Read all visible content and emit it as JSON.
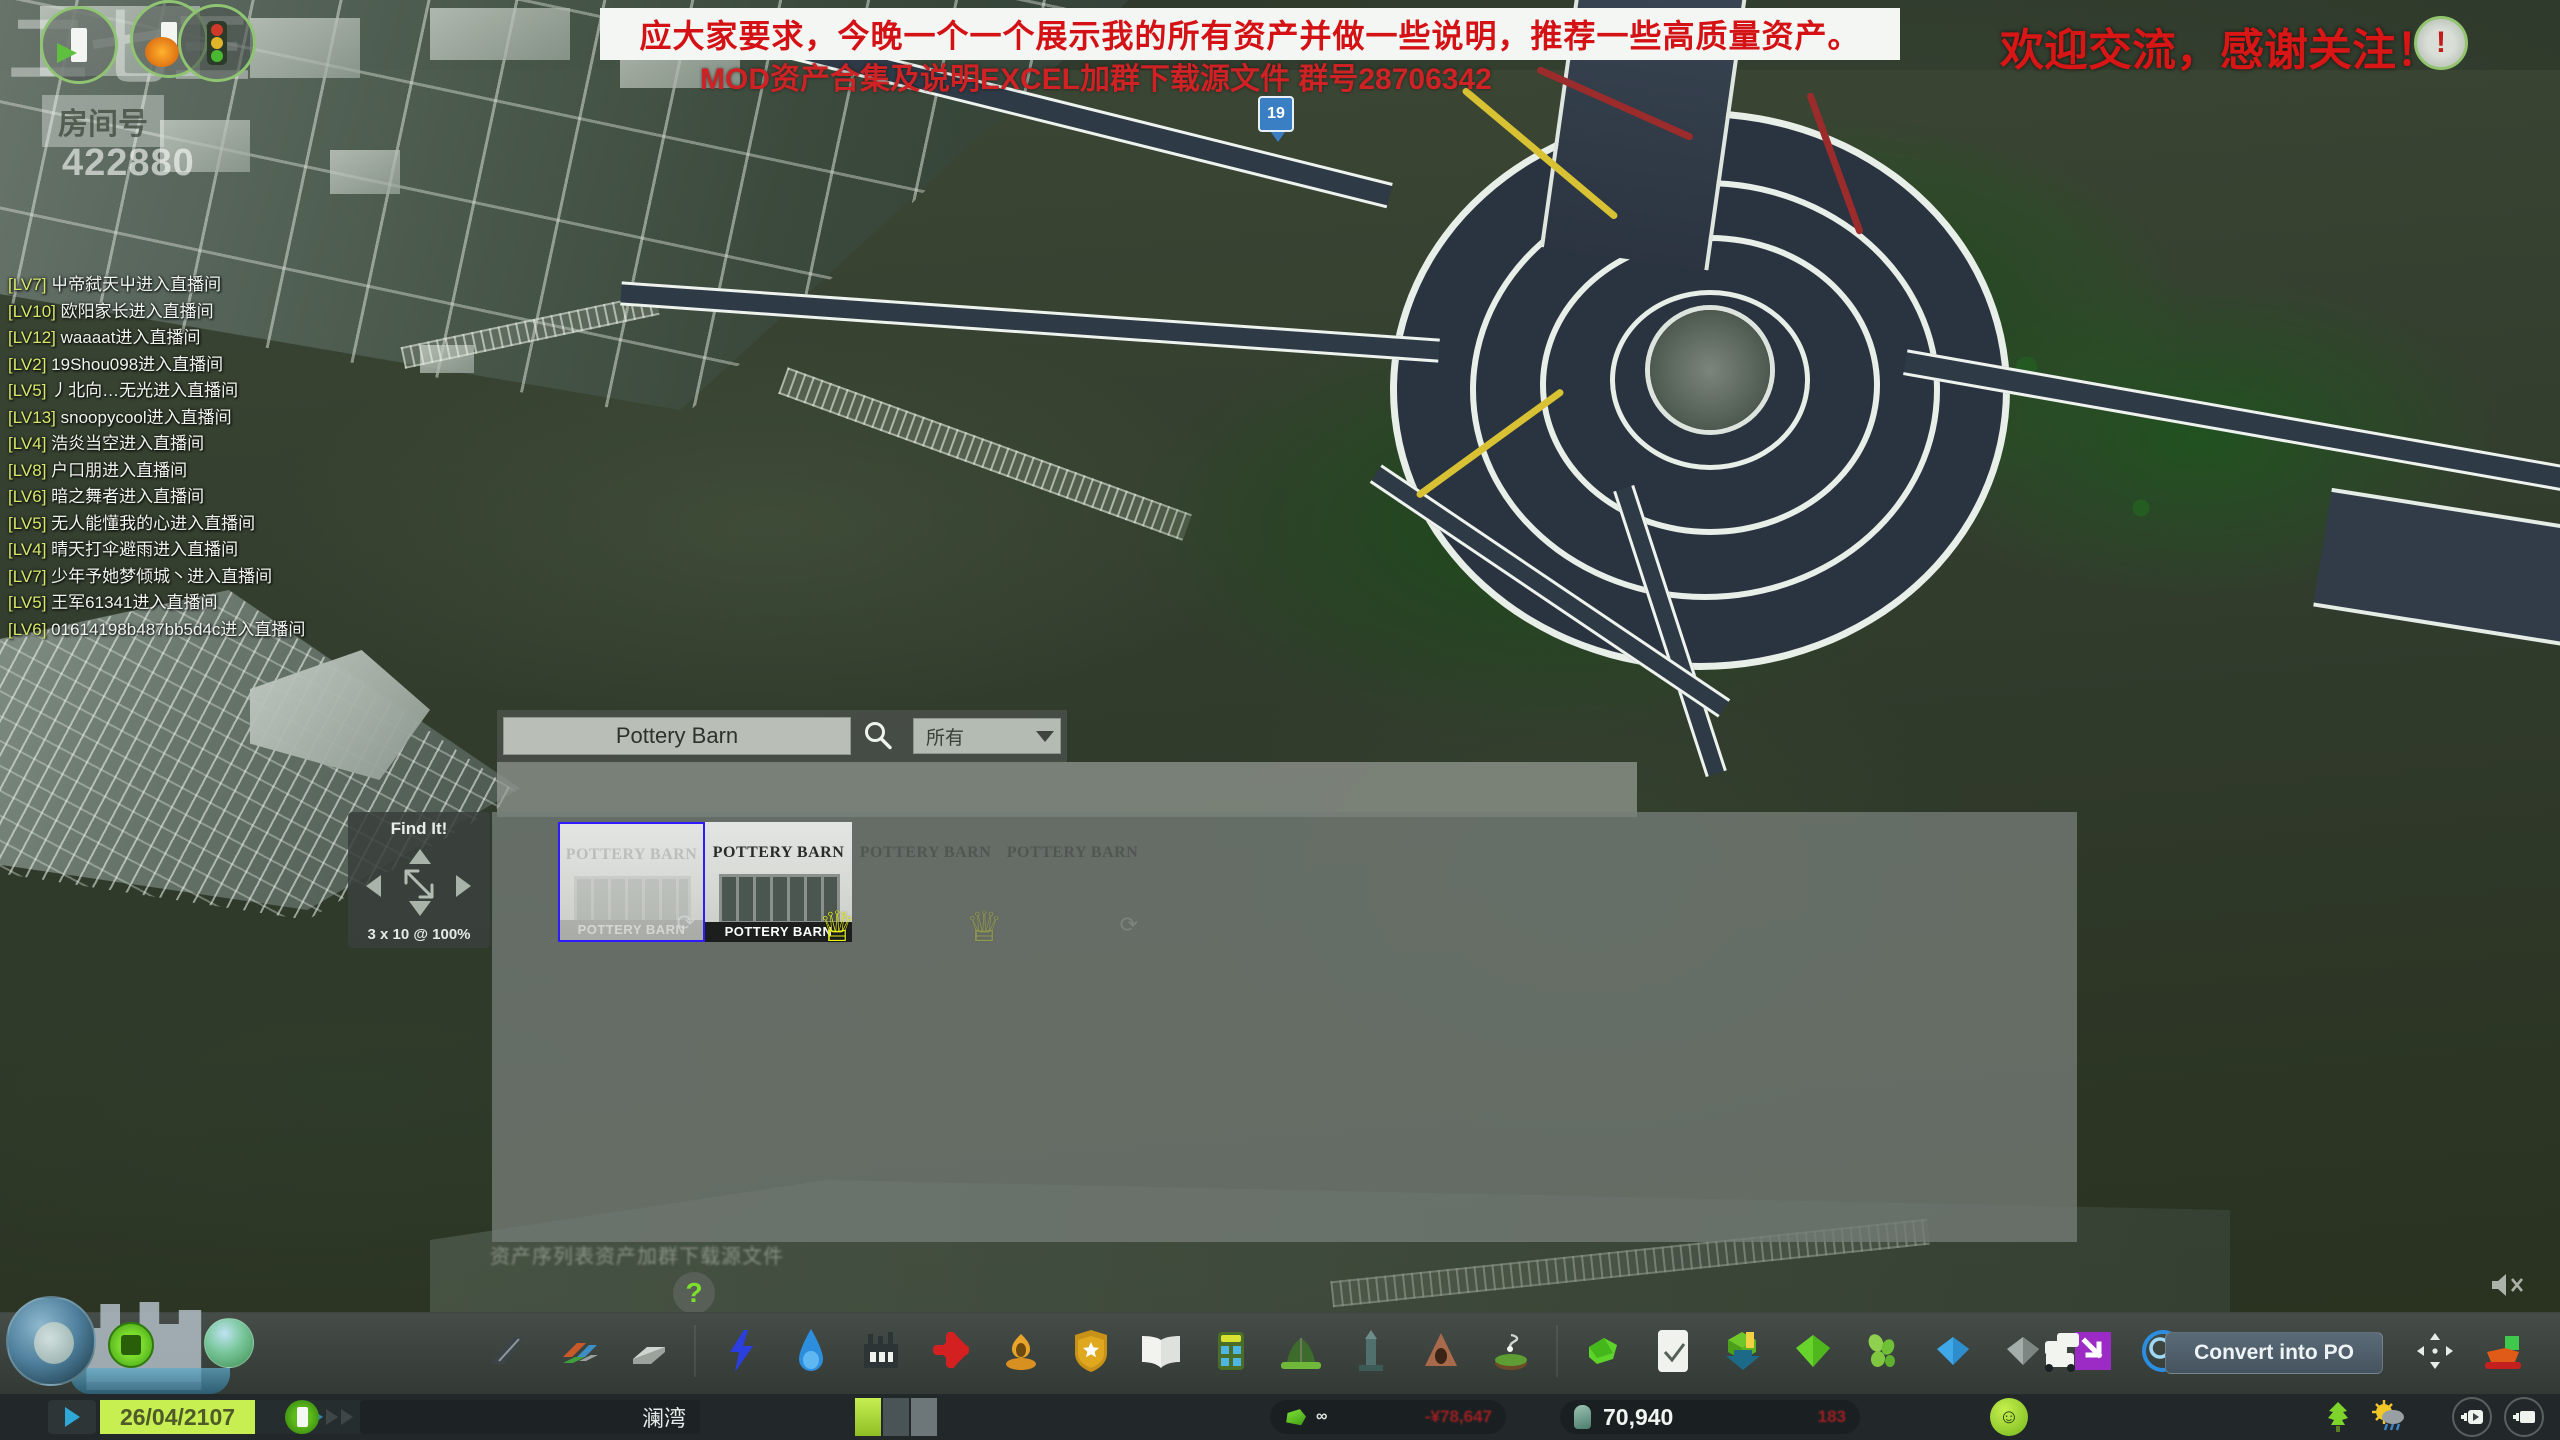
{
  "stream_overlay": {
    "watermark": "二七三",
    "room_label": "房间号",
    "room_number": "422880",
    "info_icons": [
      "transport-arrow-icon",
      "fire-hazard-icon",
      "traffic-light-icon"
    ]
  },
  "banners": {
    "main": "应大家要求，今晚一个一个展示我的所有资产并做一些说明，推荐一些高质量资产。",
    "sub": "MOD资产合集及说明EXCEL加群下载源文件 群号28706342",
    "right": "欢迎交流，感谢关注！",
    "gear_badge": "!",
    "main_color": "#d41215",
    "sub_color": "#cf2225",
    "right_color": "#d81616"
  },
  "chat": {
    "messages": [
      {
        "level": "[LV7]",
        "text": "屮帝弑天屮进入直播间"
      },
      {
        "level": "[LV10]",
        "text": "欧阳家长进入直播间"
      },
      {
        "level": "[LV12]",
        "text": "waaaat进入直播间"
      },
      {
        "level": "[LV2]",
        "text": "19Shou098进入直播间"
      },
      {
        "level": "[LV5]",
        "text": "丿北向…无光进入直播间"
      },
      {
        "level": "[LV13]",
        "text": "snoopycool进入直播间"
      },
      {
        "level": "[LV4]",
        "text": "浩炎当空进入直播间"
      },
      {
        "level": "[LV8]",
        "text": "户口朋进入直播间"
      },
      {
        "level": "[LV6]",
        "text": "暗之舞者进入直播间"
      },
      {
        "level": "[LV5]",
        "text": "无人能懂我的心进入直播间"
      },
      {
        "level": "[LV4]",
        "text": "晴天打伞避雨进入直播间"
      },
      {
        "level": "[LV7]",
        "text": "少年予她梦倾城丶进入直播间"
      },
      {
        "level": "[LV5]",
        "text": "王军61341进入直播间"
      },
      {
        "level": "[LV6]",
        "text": "01614198b487bb5d4c进入直播间"
      }
    ]
  },
  "find_it": {
    "search_value": "Pottery Barn",
    "search_placeholder": "Pottery Barn",
    "search_icon": "magnifier-icon",
    "filter_selected": "所有",
    "filter_options": [
      "所有"
    ],
    "assets": [
      {
        "name": "Pottery Barn",
        "sign_text": "POTTERY BARN",
        "awning_text": "POTTERY BARN",
        "selected": true,
        "faded": false,
        "badge": "steam-workshop-icon"
      },
      {
        "name": "Pottery Barn",
        "sign_text": "POTTERY BARN",
        "awning_text": "POTTERY BARN",
        "selected": false,
        "faded": false,
        "badge": "crown-icon"
      },
      {
        "name": "Pottery Barn",
        "sign_text": "POTTERY BARN",
        "awning_text": "POTTERY BARN",
        "selected": false,
        "faded": true,
        "badge": "crown-icon"
      },
      {
        "name": "Pottery Barn",
        "sign_text": "POTTERY BARN",
        "awning_text": "POTTERY BARN",
        "selected": false,
        "faded": true,
        "badge": "steam-workshop-icon"
      }
    ],
    "obscured_label": "资产序列表资产加群下载源文件"
  },
  "findit_panel": {
    "title": "Find It!",
    "size_label": "3 x 10 @ 100%",
    "arrows": [
      "up-arrow-icon",
      "left-arrow-icon",
      "resize-diagonal-icon",
      "right-arrow-icon",
      "down-arrow-icon"
    ]
  },
  "help": {
    "label": "?"
  },
  "toolbar": {
    "groups": [
      {
        "items": [
          {
            "icon": "road-tool-icon",
            "label": "Roads"
          },
          {
            "icon": "zoning-tool-icon",
            "label": "Zoning"
          },
          {
            "icon": "district-tool-icon",
            "label": "Districts"
          }
        ]
      },
      {
        "items": [
          {
            "icon": "electricity-icon",
            "label": "Electricity"
          },
          {
            "icon": "water-icon",
            "label": "Water & Sewage"
          },
          {
            "icon": "garbage-icon",
            "label": "Garbage"
          },
          {
            "icon": "healthcare-icon",
            "label": "Healthcare"
          },
          {
            "icon": "fire-department-icon",
            "label": "Fire Department"
          },
          {
            "icon": "police-icon",
            "label": "Police"
          },
          {
            "icon": "education-icon",
            "label": "Education"
          },
          {
            "icon": "transport-icon",
            "label": "Public Transport"
          },
          {
            "icon": "park-icon",
            "label": "Parks & Plazas"
          },
          {
            "icon": "monument-icon",
            "label": "Monuments"
          },
          {
            "icon": "landmark-icon",
            "label": "Landmarks"
          },
          {
            "icon": "golf-icon",
            "label": "Unique Buildings"
          }
        ]
      },
      {
        "items": [
          {
            "icon": "prop-green-icon",
            "label": "Props"
          },
          {
            "icon": "checkmark-icon",
            "label": "Checkbox Tool"
          },
          {
            "icon": "download-asset-icon",
            "label": "Download Assets"
          },
          {
            "icon": "green-diamond-icon",
            "label": "Green Cluster"
          },
          {
            "icon": "plants-icon",
            "label": "Plants"
          },
          {
            "icon": "blue-diamond-icon",
            "label": "Blue Cluster"
          },
          {
            "icon": "grey-diamond-icon",
            "label": "Grey Cluster"
          },
          {
            "icon": "purple-arrow-icon",
            "label": "Procedural Objects"
          },
          {
            "icon": "search-circle-icon",
            "label": "Find It"
          },
          {
            "icon": "traffic-manager-icon",
            "label": "Traffic Manager"
          }
        ]
      }
    ],
    "convert_button": "Convert into PO",
    "right_items": [
      {
        "icon": "move-it-icon",
        "label": "Move It"
      },
      {
        "icon": "bulldozer-icon",
        "label": "Bulldozer"
      }
    ]
  },
  "status_bar": {
    "play_icon": "play-icon",
    "date": "26/04/2107",
    "speed_icons": [
      "speed-1-icon",
      "speed-2-icon",
      "speed-3-icon"
    ],
    "power_icon": "power-icon",
    "city_name": "澜湾",
    "money": {
      "icon": "money-gem-icon",
      "value": "∞",
      "delta": "-¥78,647"
    },
    "population": {
      "icon": "population-icon",
      "value": "70,940",
      "delta": "183"
    },
    "happiness_icon": "happy-face-icon",
    "tree_icon": "tree-icon",
    "weather_icon": "weather-sun-rain-icon",
    "camera_buttons": [
      "cinematic-camera-icon",
      "free-camera-icon"
    ]
  },
  "map": {
    "pin_label": "19",
    "mute_icon": "mute-icon"
  },
  "colors": {
    "accent_green": "#8fc472",
    "banner_red": "#d41215",
    "date_green": "#c7ef52",
    "selection_blue": "#1400f0",
    "crown_yellow": "#e8f018"
  }
}
